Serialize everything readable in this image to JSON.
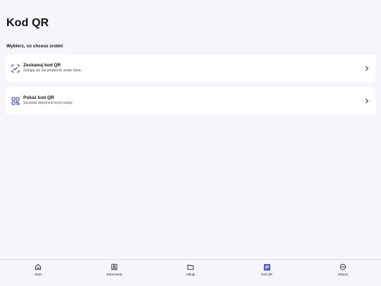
{
  "page": {
    "title": "Kod QR",
    "subtitle": "Wybierz, co chcesz zrobić"
  },
  "options": [
    {
      "title": "Zeskanuj kod QR",
      "description": "Zaloguj się lub potwierdź swoje dane.",
      "icon": "scan-qr-icon"
    },
    {
      "title": "Pokaż kod QR",
      "description": "Sprawdź dokument innej osoby.",
      "icon": "qr-code-icon"
    }
  ],
  "tabs": [
    {
      "label": "Start",
      "icon": "home-icon"
    },
    {
      "label": "Dokumenty",
      "icon": "id-card-icon"
    },
    {
      "label": "Usługi",
      "icon": "folder-icon"
    },
    {
      "label": "Kod QR",
      "icon": "qr-code-icon",
      "active": true
    },
    {
      "label": "Więcej",
      "icon": "more-icon"
    }
  ],
  "colors": {
    "accent": "#2a3fb8",
    "background": "#f5f6fa",
    "card": "#ffffff"
  }
}
